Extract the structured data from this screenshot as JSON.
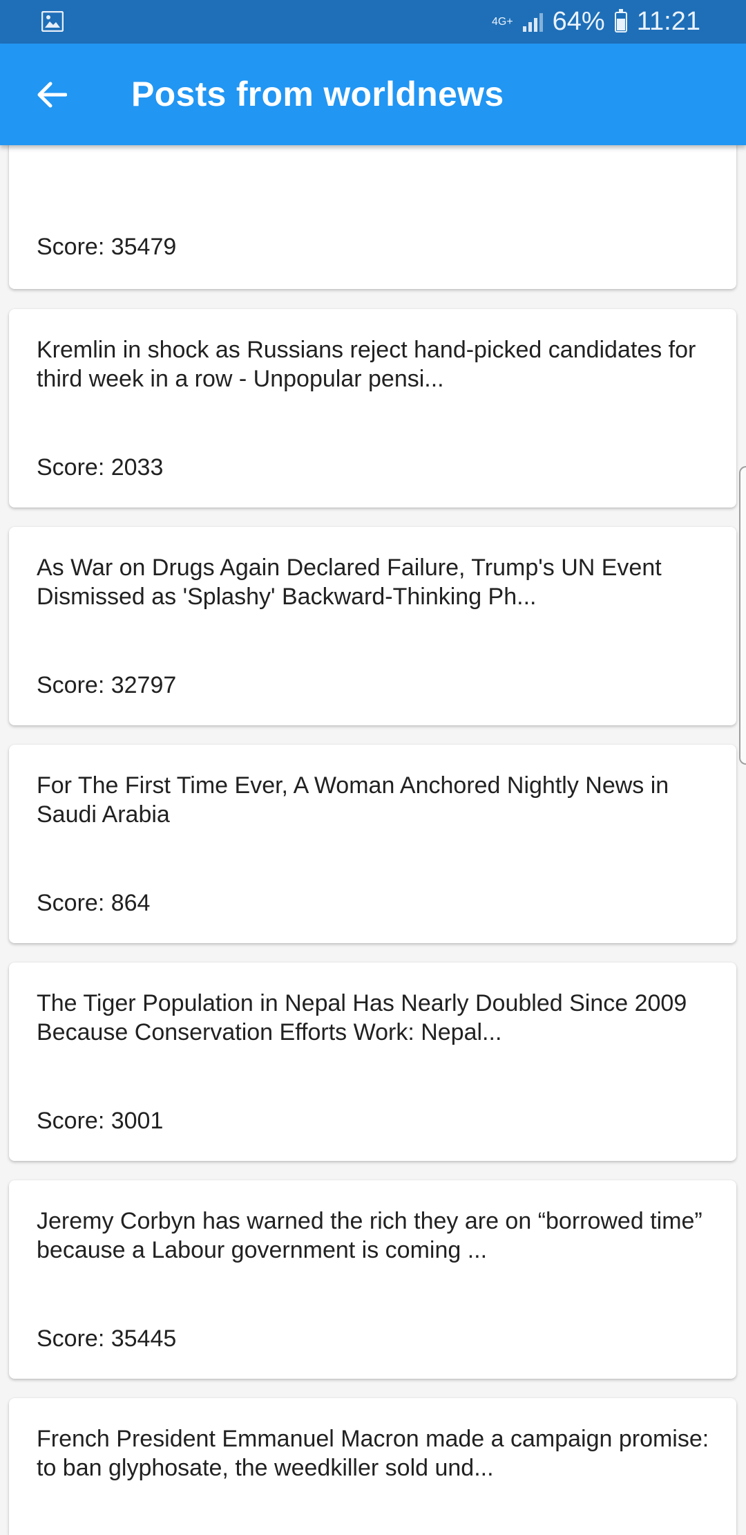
{
  "status_bar": {
    "network": "4G+",
    "battery": "64%",
    "time": "11:21",
    "icons": [
      "image-icon",
      "signal-icon",
      "battery-icon"
    ]
  },
  "app_bar": {
    "title": "Posts from worldnews",
    "back_icon": "arrow-left-icon",
    "color": "#2196f3"
  },
  "posts": [
    {
      "title": "",
      "score": "Score: 35479"
    },
    {
      "title": "Kremlin in shock as Russians reject hand-picked candidates for third week in a row - Unpopular pensi...",
      "score": "Score: 2033"
    },
    {
      "title": "As War on Drugs Again Declared Failure, Trump's UN Event Dismissed as 'Splashy' Backward-Thinking Ph...",
      "score": "Score: 32797"
    },
    {
      "title": "For The First Time Ever, A Woman Anchored Nightly News in Saudi Arabia",
      "score": "Score: 864"
    },
    {
      "title": "The Tiger Population in Nepal Has Nearly Doubled Since 2009 Because Conservation Efforts Work: Nepal...",
      "score": "Score: 3001"
    },
    {
      "title": "Jeremy Corbyn has warned the rich they are on “borrowed time” because a Labour government is coming ...",
      "score": "Score: 35445"
    },
    {
      "title": "French President Emmanuel Macron made a campaign promise: to ban glyphosate, the weedkiller sold und...",
      "score": ""
    }
  ]
}
